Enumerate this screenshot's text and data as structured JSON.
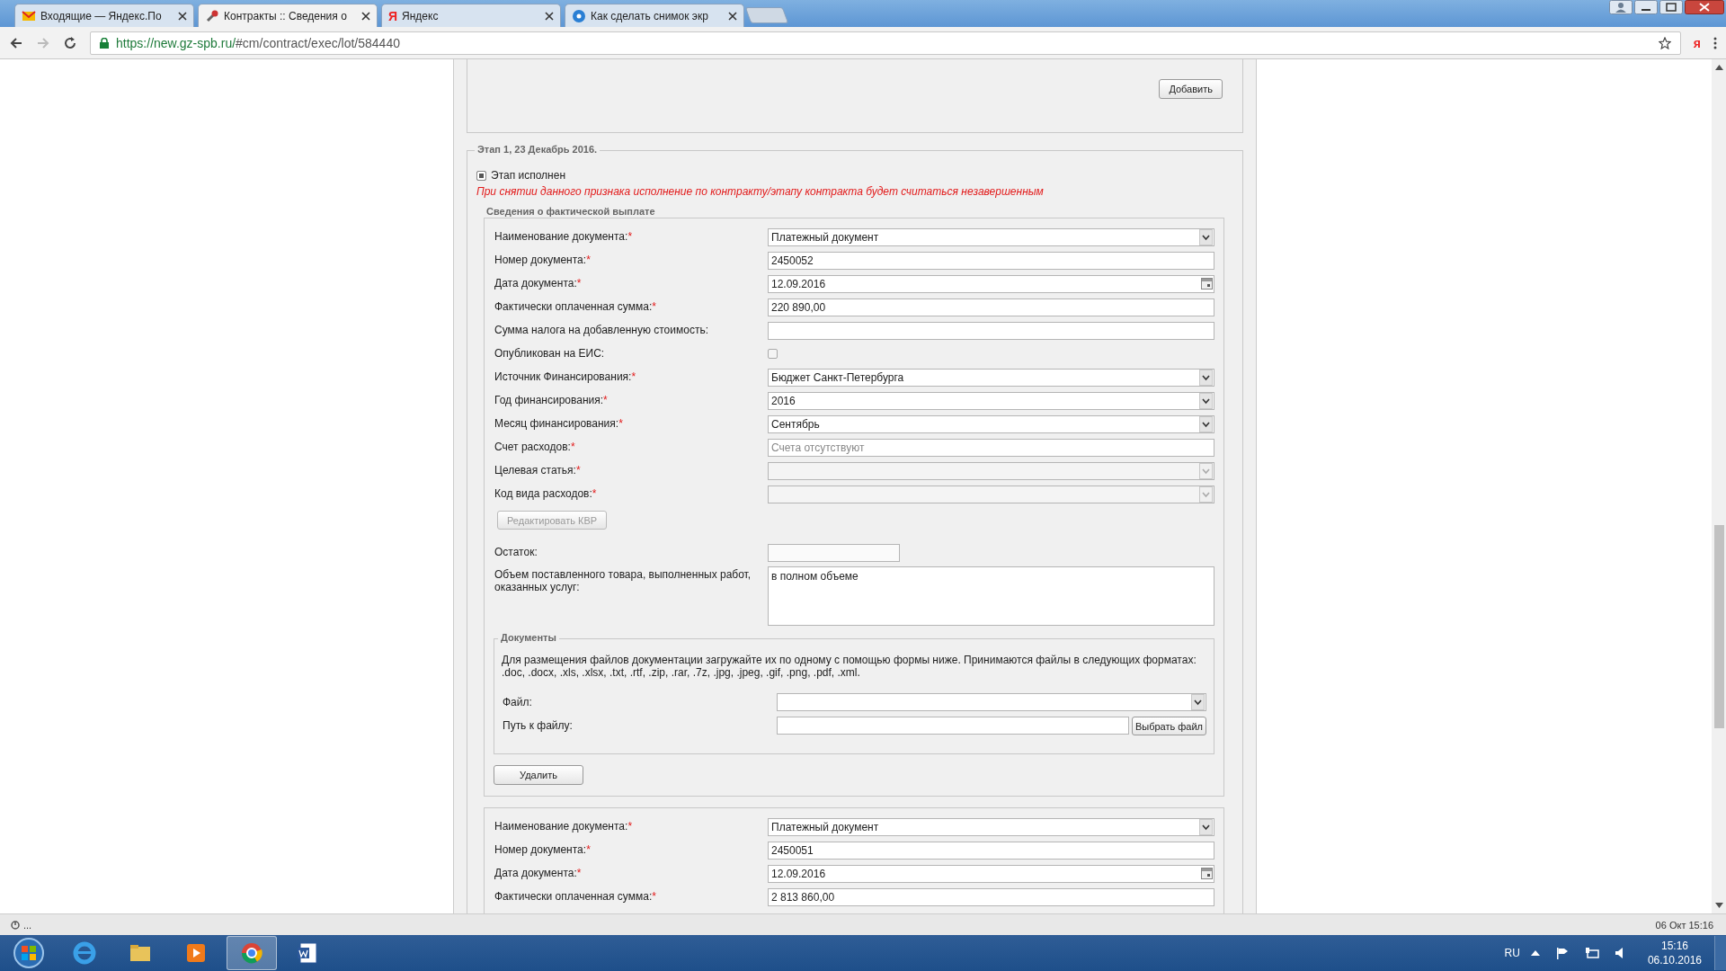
{
  "browser": {
    "tabs": [
      {
        "title": "Входящие — Яндекс.По",
        "kind": "mail",
        "selected": false
      },
      {
        "title": "Контракты :: Сведения о",
        "kind": "tools",
        "selected": true
      },
      {
        "title": "Яндекс",
        "kind": "letter",
        "icon_text": "Я",
        "selected": false
      },
      {
        "title": "Как сделать снимок экр",
        "kind": "help",
        "selected": false
      }
    ],
    "url": {
      "host": "https://new.gz-spb.ru/",
      "path": "#cm/contract/exec/lot/584440"
    },
    "toolbar_badge": "я"
  },
  "required_mark": "*",
  "top_panel": {
    "button": "Добавить"
  },
  "stage": {
    "legend": "Этап 1, 23 Декабрь 2016.",
    "completed": {
      "label": "Этап исполнен",
      "checked": true
    },
    "warning": "При снятии данного признака исполнение по контракту/этапу контракта будет считаться незавершенным",
    "groups": [
      {
        "legend": "Сведения о фактической выплате",
        "rows": [
          {
            "kind": "select",
            "label": "Наименование документа:",
            "required": true,
            "value": "Платежный документ",
            "disabled": false
          },
          {
            "kind": "input",
            "label": "Номер документа:",
            "required": true,
            "value": "2450052"
          },
          {
            "kind": "date",
            "label": "Дата документа:",
            "required": true,
            "value": "12.09.2016"
          },
          {
            "kind": "input",
            "label": "Фактически оплаченная сумма:",
            "required": true,
            "value": "220 890,00"
          },
          {
            "kind": "input",
            "label": "Сумма налога на добавленную стоимость:",
            "required": false
          },
          {
            "kind": "checkbox",
            "label": "Опубликован на ЕИС:",
            "required": false,
            "checked": false
          },
          {
            "kind": "select",
            "label": "Источник Финансирования:",
            "required": true,
            "value": "Бюджет Санкт-Петербурга",
            "disabled": false
          },
          {
            "kind": "select",
            "label": "Год финансирования:",
            "required": true,
            "value": "2016",
            "disabled": false
          },
          {
            "kind": "select",
            "label": "Месяц финансирования:",
            "required": true,
            "value": "Сентябрь",
            "disabled": false
          },
          {
            "kind": "input",
            "label": "Счет расходов:",
            "required": true,
            "placeholder": "Счета отсутствуют"
          },
          {
            "kind": "select",
            "label": "Целевая статья:",
            "required": true,
            "disabled": true
          },
          {
            "kind": "select",
            "label": "Код вида расходов:",
            "required": true,
            "disabled": true
          },
          {
            "kind": "button",
            "label": "Редактировать КВР",
            "disabled": true
          },
          {
            "kind": "short",
            "label": "Остаток:",
            "required": false
          },
          {
            "kind": "textarea",
            "label": "Объем поставленного товара, выполненных работ, оказанных услуг:",
            "required": false,
            "value": "в полном объеме"
          }
        ],
        "documents": {
          "legend": "Документы",
          "description": "Для размещения файлов документации загружайте их по одному с помощью формы ниже. Принимаются файлы в следующих форматах: .doc, .docx, .xls, .xlsx, .txt, .rtf, .zip, .rar, .7z, .jpg, .jpeg, .gif, .png, .pdf, .xml.",
          "file_label": "Файл:",
          "path_label": "Путь к файлу:",
          "browse_button": "Выбрать файл"
        },
        "delete_button": "Удалить"
      },
      {
        "rows": [
          {
            "kind": "select",
            "label": "Наименование документа:",
            "required": true,
            "value": "Платежный документ",
            "disabled": false
          },
          {
            "kind": "input",
            "label": "Номер документа:",
            "required": true,
            "value": "2450051"
          },
          {
            "kind": "date",
            "label": "Дата документа:",
            "required": true,
            "value": "12.09.2016"
          },
          {
            "kind": "input",
            "label": "Фактически оплаченная сумма:",
            "required": true,
            "value": "2 813 860,00"
          }
        ]
      }
    ]
  },
  "status_bar": {
    "left": "...",
    "right": "06 Окт 15:16"
  },
  "taskbar": {
    "apps": [
      {
        "kind": "browser",
        "active": false
      },
      {
        "kind": "folder",
        "active": false
      },
      {
        "kind": "player",
        "active": false
      },
      {
        "kind": "chrome",
        "active": true
      },
      {
        "kind": "word",
        "active": false
      }
    ],
    "language": "RU",
    "time": "15:16",
    "date": "06.10.2016"
  }
}
